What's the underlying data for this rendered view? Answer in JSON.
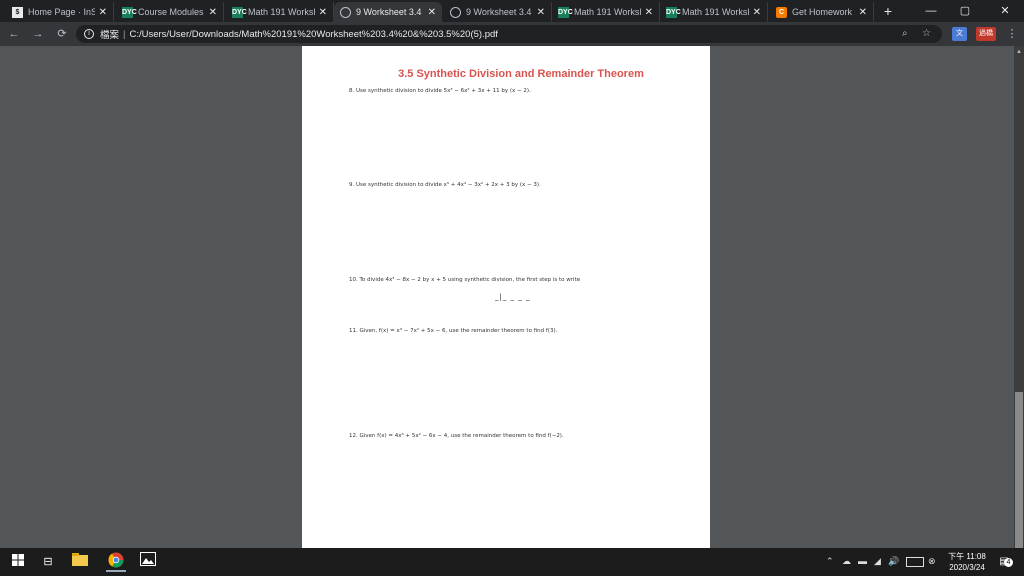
{
  "tabs": [
    {
      "label": "Home Page · InS",
      "icon": "home-favicon",
      "active": false
    },
    {
      "label": "Course Modules",
      "icon": "dyc-favicon",
      "active": false
    },
    {
      "label": "Math 191 Worksh",
      "icon": "dyc-favicon",
      "active": false
    },
    {
      "label": "9 Worksheet 3.4",
      "icon": "globe-favicon",
      "active": true
    },
    {
      "label": "9 Worksheet 3.4",
      "icon": "globe-favicon",
      "active": false
    },
    {
      "label": "Math 191 Worksh",
      "icon": "dyc-favicon",
      "active": false
    },
    {
      "label": "Math 191 Worksh",
      "icon": "dyc-favicon",
      "active": false
    },
    {
      "label": "Get Homework H",
      "icon": "chegg-favicon",
      "active": false
    }
  ],
  "favicon_text": {
    "dyc": "DYC",
    "c": "C",
    "home": "$"
  },
  "toolbar": {
    "scheme_label": "檔案",
    "url": "C:/Users/User/Downloads/Math%20191%20Worksheet%203.4%20&%203.5%20(5).pdf",
    "ext_label": "過橋"
  },
  "document": {
    "title": "3.5 Synthetic Division and Remainder Theorem",
    "problems": [
      {
        "number": "8.",
        "text": "Use synthetic division to divide 5x³ − 6x² + 3x + 11 by (x − 2)."
      },
      {
        "number": "9.",
        "text": "Use synthetic division to divide x⁵ + 4x⁴ − 3x² + 2x + 3 by (x − 3)."
      },
      {
        "number": "10.",
        "text": "To divide 4x³ − 8x − 2 by x + 5 using synthetic division, the first step is to write"
      },
      {
        "number": "11.",
        "text": "Given, f(x) = x³ − 7x² + 5x − 6, use the remainder theorem to find f(3)."
      },
      {
        "number": "12.",
        "text": "Given f(x) = 4x³ + 5x² − 6x − 4, use the remainder theorem to find f(−2)."
      }
    ],
    "blank_template": "_|_ _ _ _"
  },
  "taskbar": {
    "clock_time": "下午 11:08",
    "clock_date": "2020/3/24",
    "notification_count": "4"
  },
  "colors": {
    "title_red": "#d9534f",
    "tab_bg": "#202124",
    "toolbar_bg": "#35363a",
    "viewer_bg": "#525659"
  }
}
